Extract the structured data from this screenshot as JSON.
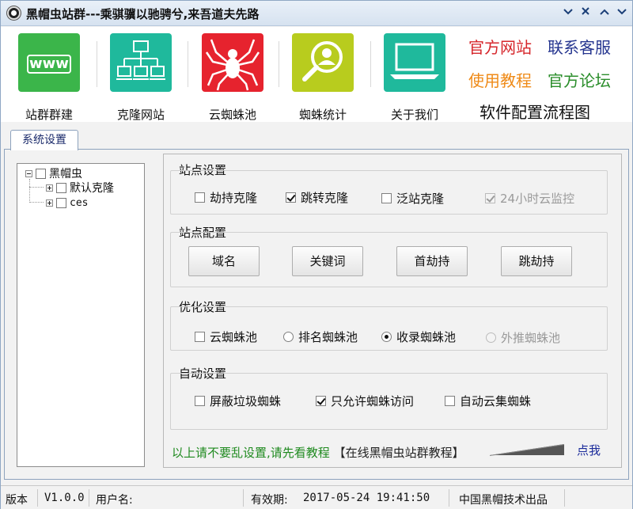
{
  "window": {
    "title": "黑帽虫站群---乘骐骥以驰骋兮,来吾道夫先路",
    "controls": [
      "minimize-chevron-icon",
      "close-x-icon",
      "collapse-chevron-icon",
      "restore-chevron-icon"
    ]
  },
  "toolbar": {
    "items": [
      {
        "label": "站群群建",
        "icon": "www-icon",
        "color": "#3bb54a"
      },
      {
        "label": "克隆网站",
        "icon": "network-icon",
        "color": "#1fb99c"
      },
      {
        "label": "云蜘蛛池",
        "icon": "spider-icon",
        "color": "#e6232e"
      },
      {
        "label": "蜘蛛统计",
        "icon": "magnifier-user-icon",
        "color": "#b8cc1e"
      },
      {
        "label": "关于我们",
        "icon": "laptop-icon",
        "color": "#1fb99c"
      }
    ],
    "links": [
      {
        "label": "官方网站",
        "color": "#d6262b"
      },
      {
        "label": "联系客服",
        "color": "#25358f"
      },
      {
        "label": "使用教程",
        "color": "#ef8a17"
      },
      {
        "label": "官方论坛",
        "color": "#2a8d2a"
      }
    ],
    "flow_label": "软件配置流程图"
  },
  "tabs": [
    {
      "label": "系统设置",
      "active": true
    }
  ],
  "tree": {
    "root": "黑帽虫",
    "children": [
      "默认克隆",
      "ces"
    ]
  },
  "groups": {
    "site_settings": {
      "title": "站点设置",
      "options": [
        {
          "label": "劫持克隆",
          "checked": false,
          "disabled": false
        },
        {
          "label": "跳转克隆",
          "checked": true,
          "disabled": false
        },
        {
          "label": "泛站克隆",
          "checked": false,
          "disabled": false
        },
        {
          "label": "24小时云监控",
          "checked": true,
          "disabled": true
        }
      ]
    },
    "site_config": {
      "title": "站点配置",
      "buttons": [
        "域名",
        "关键词",
        "首劫持",
        "跳劫持"
      ]
    },
    "optimize": {
      "title": "优化设置",
      "options": [
        {
          "label": "云蜘蛛池",
          "type": "checkbox",
          "checked": false,
          "disabled": false
        },
        {
          "label": "排名蜘蛛池",
          "type": "radio",
          "checked": false,
          "disabled": false
        },
        {
          "label": "收录蜘蛛池",
          "type": "radio",
          "checked": true,
          "disabled": false
        },
        {
          "label": "外推蜘蛛池",
          "type": "radio",
          "checked": false,
          "disabled": true
        }
      ]
    },
    "auto": {
      "title": "自动设置",
      "options": [
        {
          "label": "屏蔽垃圾蜘蛛",
          "checked": false
        },
        {
          "label": "只允许蜘蛛访问",
          "checked": true
        },
        {
          "label": "自动云集蜘蛛",
          "checked": false
        }
      ]
    }
  },
  "notice": {
    "warning": "以上请不要乱设置,请先看教程",
    "tutorial": "【在线黑帽虫站群教程】",
    "click": "点我"
  },
  "status": {
    "version_label": "版本",
    "version": "V1.0.0",
    "user_label": "用户名:",
    "expiry_label": "有效期:",
    "expiry": "2017-05-24 19:41:50",
    "vendor": "中国黑帽技术出品"
  }
}
